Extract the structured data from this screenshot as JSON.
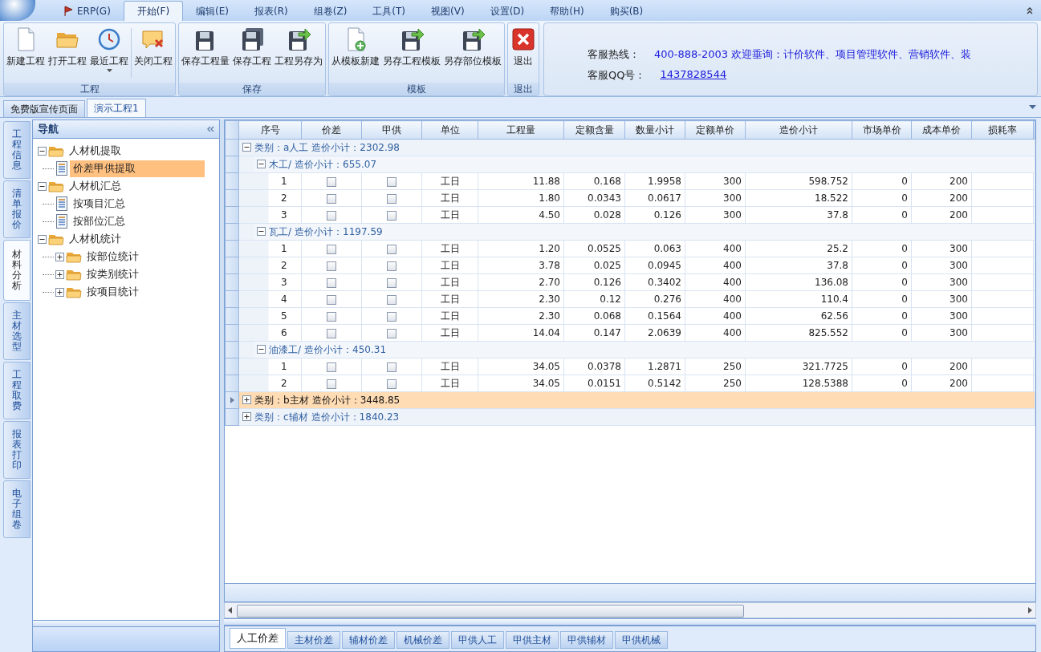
{
  "menu": {
    "items": [
      {
        "label": "ERP(G)",
        "kind": "flag",
        "selected": false
      },
      {
        "label": "开始(F)",
        "kind": "plain",
        "selected": true
      },
      {
        "label": "编辑(E)",
        "kind": "plain",
        "selected": false
      },
      {
        "label": "报表(R)",
        "kind": "plain",
        "selected": false
      },
      {
        "label": "组卷(Z)",
        "kind": "plain",
        "selected": false
      },
      {
        "label": "工具(T)",
        "kind": "plain",
        "selected": false
      },
      {
        "label": "视图(V)",
        "kind": "plain",
        "selected": false
      },
      {
        "label": "设置(D)",
        "kind": "plain",
        "selected": false
      },
      {
        "label": "帮助(H)",
        "kind": "plain",
        "selected": false
      },
      {
        "label": "购买(B)",
        "kind": "plain",
        "selected": false
      }
    ]
  },
  "ribbon": {
    "groups": [
      {
        "title": "工程",
        "buttons": [
          {
            "label": "新建工程",
            "kind": "new"
          },
          {
            "label": "打开工程",
            "kind": "open"
          },
          {
            "label": "最近工程",
            "kind": "recent"
          },
          {
            "label": "关闭工程",
            "kind": "close"
          }
        ]
      },
      {
        "title": "保存",
        "buttons": [
          {
            "label": "保存工程量",
            "kind": "save"
          },
          {
            "label": "保存工程",
            "kind": "save-all"
          },
          {
            "label": "工程另存为",
            "kind": "save-as"
          }
        ]
      },
      {
        "title": "模板",
        "buttons": [
          {
            "label": "从模板新建",
            "kind": "template"
          },
          {
            "label": "另存工程模板",
            "kind": "save-as"
          },
          {
            "label": "另存部位模板",
            "kind": "save-as"
          }
        ]
      },
      {
        "title": "退出",
        "buttons": [
          {
            "label": "退出",
            "kind": "exit"
          }
        ]
      }
    ],
    "info": {
      "hotline_label": "客服热线：",
      "hotline_value": "400-888-2003 欢迎垂询：计价软件、项目管理软件、营销软件、装",
      "qq_label": "客服QQ号：",
      "qq_link": "1437828544"
    }
  },
  "doc_tabs": [
    {
      "label": "免费版宣传页面",
      "selected": false
    },
    {
      "label": "演示工程1",
      "selected": true
    }
  ],
  "side_tabs": [
    {
      "label": "工程信息",
      "selected": false
    },
    {
      "label": "清单报价",
      "selected": false
    },
    {
      "label": "材料分析",
      "selected": true
    },
    {
      "label": "主材选型",
      "selected": false
    },
    {
      "label": "工程取费",
      "selected": false
    },
    {
      "label": "报表打印",
      "selected": false
    },
    {
      "label": "电子组卷",
      "selected": false
    }
  ],
  "nav": {
    "title": "导航",
    "tree": [
      {
        "label": "人材机提取",
        "expanded": true,
        "selected": false,
        "children": [
          {
            "label": "价差甲供提取",
            "selected": true
          }
        ]
      },
      {
        "label": "人材机汇总",
        "expanded": true,
        "selected": false,
        "children": [
          {
            "label": "按项目汇总",
            "selected": false
          },
          {
            "label": "按部位汇总",
            "selected": false
          }
        ]
      },
      {
        "label": "人材机统计",
        "expanded": true,
        "selected": false,
        "children": [
          {
            "label": "按部位统计",
            "kind": "folder",
            "expanded": false,
            "selected": false
          },
          {
            "label": "按类别统计",
            "kind": "folder",
            "expanded": false,
            "selected": false
          },
          {
            "label": "按项目统计",
            "kind": "folder",
            "expanded": false,
            "selected": false
          }
        ]
      }
    ]
  },
  "table": {
    "columns": [
      "序号",
      "价差",
      "甲供",
      "单位",
      "工程量",
      "定额含量",
      "数量小计",
      "定额单价",
      "造价小计",
      "市场单价",
      "成本单价",
      "损耗率"
    ],
    "categories": [
      {
        "label": "类别：a人工",
        "subtotal": "造价小计：2302.98",
        "expanded": true,
        "selected": false,
        "children": [
          {
            "label": "木工/",
            "subtotal": "造价小计：655.07",
            "expanded": true,
            "children": [
              {
                "no": "1",
                "price_diff": false,
                "supplied": false,
                "unit": "工日",
                "values": [
                  "11.88",
                  "0.168",
                  "1.9958",
                  "300",
                  "598.752",
                  "0",
                  "200"
                ]
              },
              {
                "no": "2",
                "price_diff": false,
                "supplied": false,
                "unit": "工日",
                "values": [
                  "1.80",
                  "0.0343",
                  "0.0617",
                  "300",
                  "18.522",
                  "0",
                  "200"
                ]
              },
              {
                "no": "3",
                "price_diff": false,
                "supplied": false,
                "unit": "工日",
                "values": [
                  "4.50",
                  "0.028",
                  "0.126",
                  "300",
                  "37.8",
                  "0",
                  "200"
                ]
              }
            ]
          },
          {
            "label": "瓦工/",
            "subtotal": "造价小计：1197.59",
            "expanded": true,
            "children": [
              {
                "no": "1",
                "price_diff": false,
                "supplied": false,
                "unit": "工日",
                "values": [
                  "1.20",
                  "0.0525",
                  "0.063",
                  "400",
                  "25.2",
                  "0",
                  "300"
                ]
              },
              {
                "no": "2",
                "price_diff": false,
                "supplied": false,
                "unit": "工日",
                "values": [
                  "3.78",
                  "0.025",
                  "0.0945",
                  "400",
                  "37.8",
                  "0",
                  "300"
                ]
              },
              {
                "no": "3",
                "price_diff": false,
                "supplied": false,
                "unit": "工日",
                "values": [
                  "2.70",
                  "0.126",
                  "0.3402",
                  "400",
                  "136.08",
                  "0",
                  "300"
                ]
              },
              {
                "no": "4",
                "price_diff": false,
                "supplied": false,
                "unit": "工日",
                "values": [
                  "2.30",
                  "0.12",
                  "0.276",
                  "400",
                  "110.4",
                  "0",
                  "300"
                ]
              },
              {
                "no": "5",
                "price_diff": false,
                "supplied": false,
                "unit": "工日",
                "values": [
                  "2.30",
                  "0.068",
                  "0.1564",
                  "400",
                  "62.56",
                  "0",
                  "300"
                ]
              },
              {
                "no": "6",
                "price_diff": false,
                "supplied": false,
                "unit": "工日",
                "values": [
                  "14.04",
                  "0.147",
                  "2.0639",
                  "400",
                  "825.552",
                  "0",
                  "300"
                ]
              }
            ]
          },
          {
            "label": "油漆工/",
            "subtotal": "造价小计：450.31",
            "expanded": true,
            "children": [
              {
                "no": "1",
                "price_diff": false,
                "supplied": false,
                "unit": "工日",
                "values": [
                  "34.05",
                  "0.0378",
                  "1.2871",
                  "250",
                  "321.7725",
                  "0",
                  "200"
                ]
              },
              {
                "no": "2",
                "price_diff": false,
                "supplied": false,
                "unit": "工日",
                "values": [
                  "34.05",
                  "0.0151",
                  "0.5142",
                  "250",
                  "128.5388",
                  "0",
                  "200"
                ]
              }
            ]
          }
        ]
      },
      {
        "label": "类别：b主材",
        "subtotal": "造价小计：3448.85",
        "expanded": false,
        "selected": true
      },
      {
        "label": "类别：c辅材",
        "subtotal": "造价小计：1840.23",
        "expanded": false,
        "selected": false
      }
    ]
  },
  "bottom_tabs": [
    {
      "label": "人工价差",
      "selected": true
    },
    {
      "label": "主材价差",
      "selected": false
    },
    {
      "label": "辅材价差",
      "selected": false
    },
    {
      "label": "机械价差",
      "selected": false
    },
    {
      "label": "甲供人工",
      "selected": false
    },
    {
      "label": "甲供主材",
      "selected": false
    },
    {
      "label": "甲供辅材",
      "selected": false
    },
    {
      "label": "甲供机械",
      "selected": false
    }
  ]
}
